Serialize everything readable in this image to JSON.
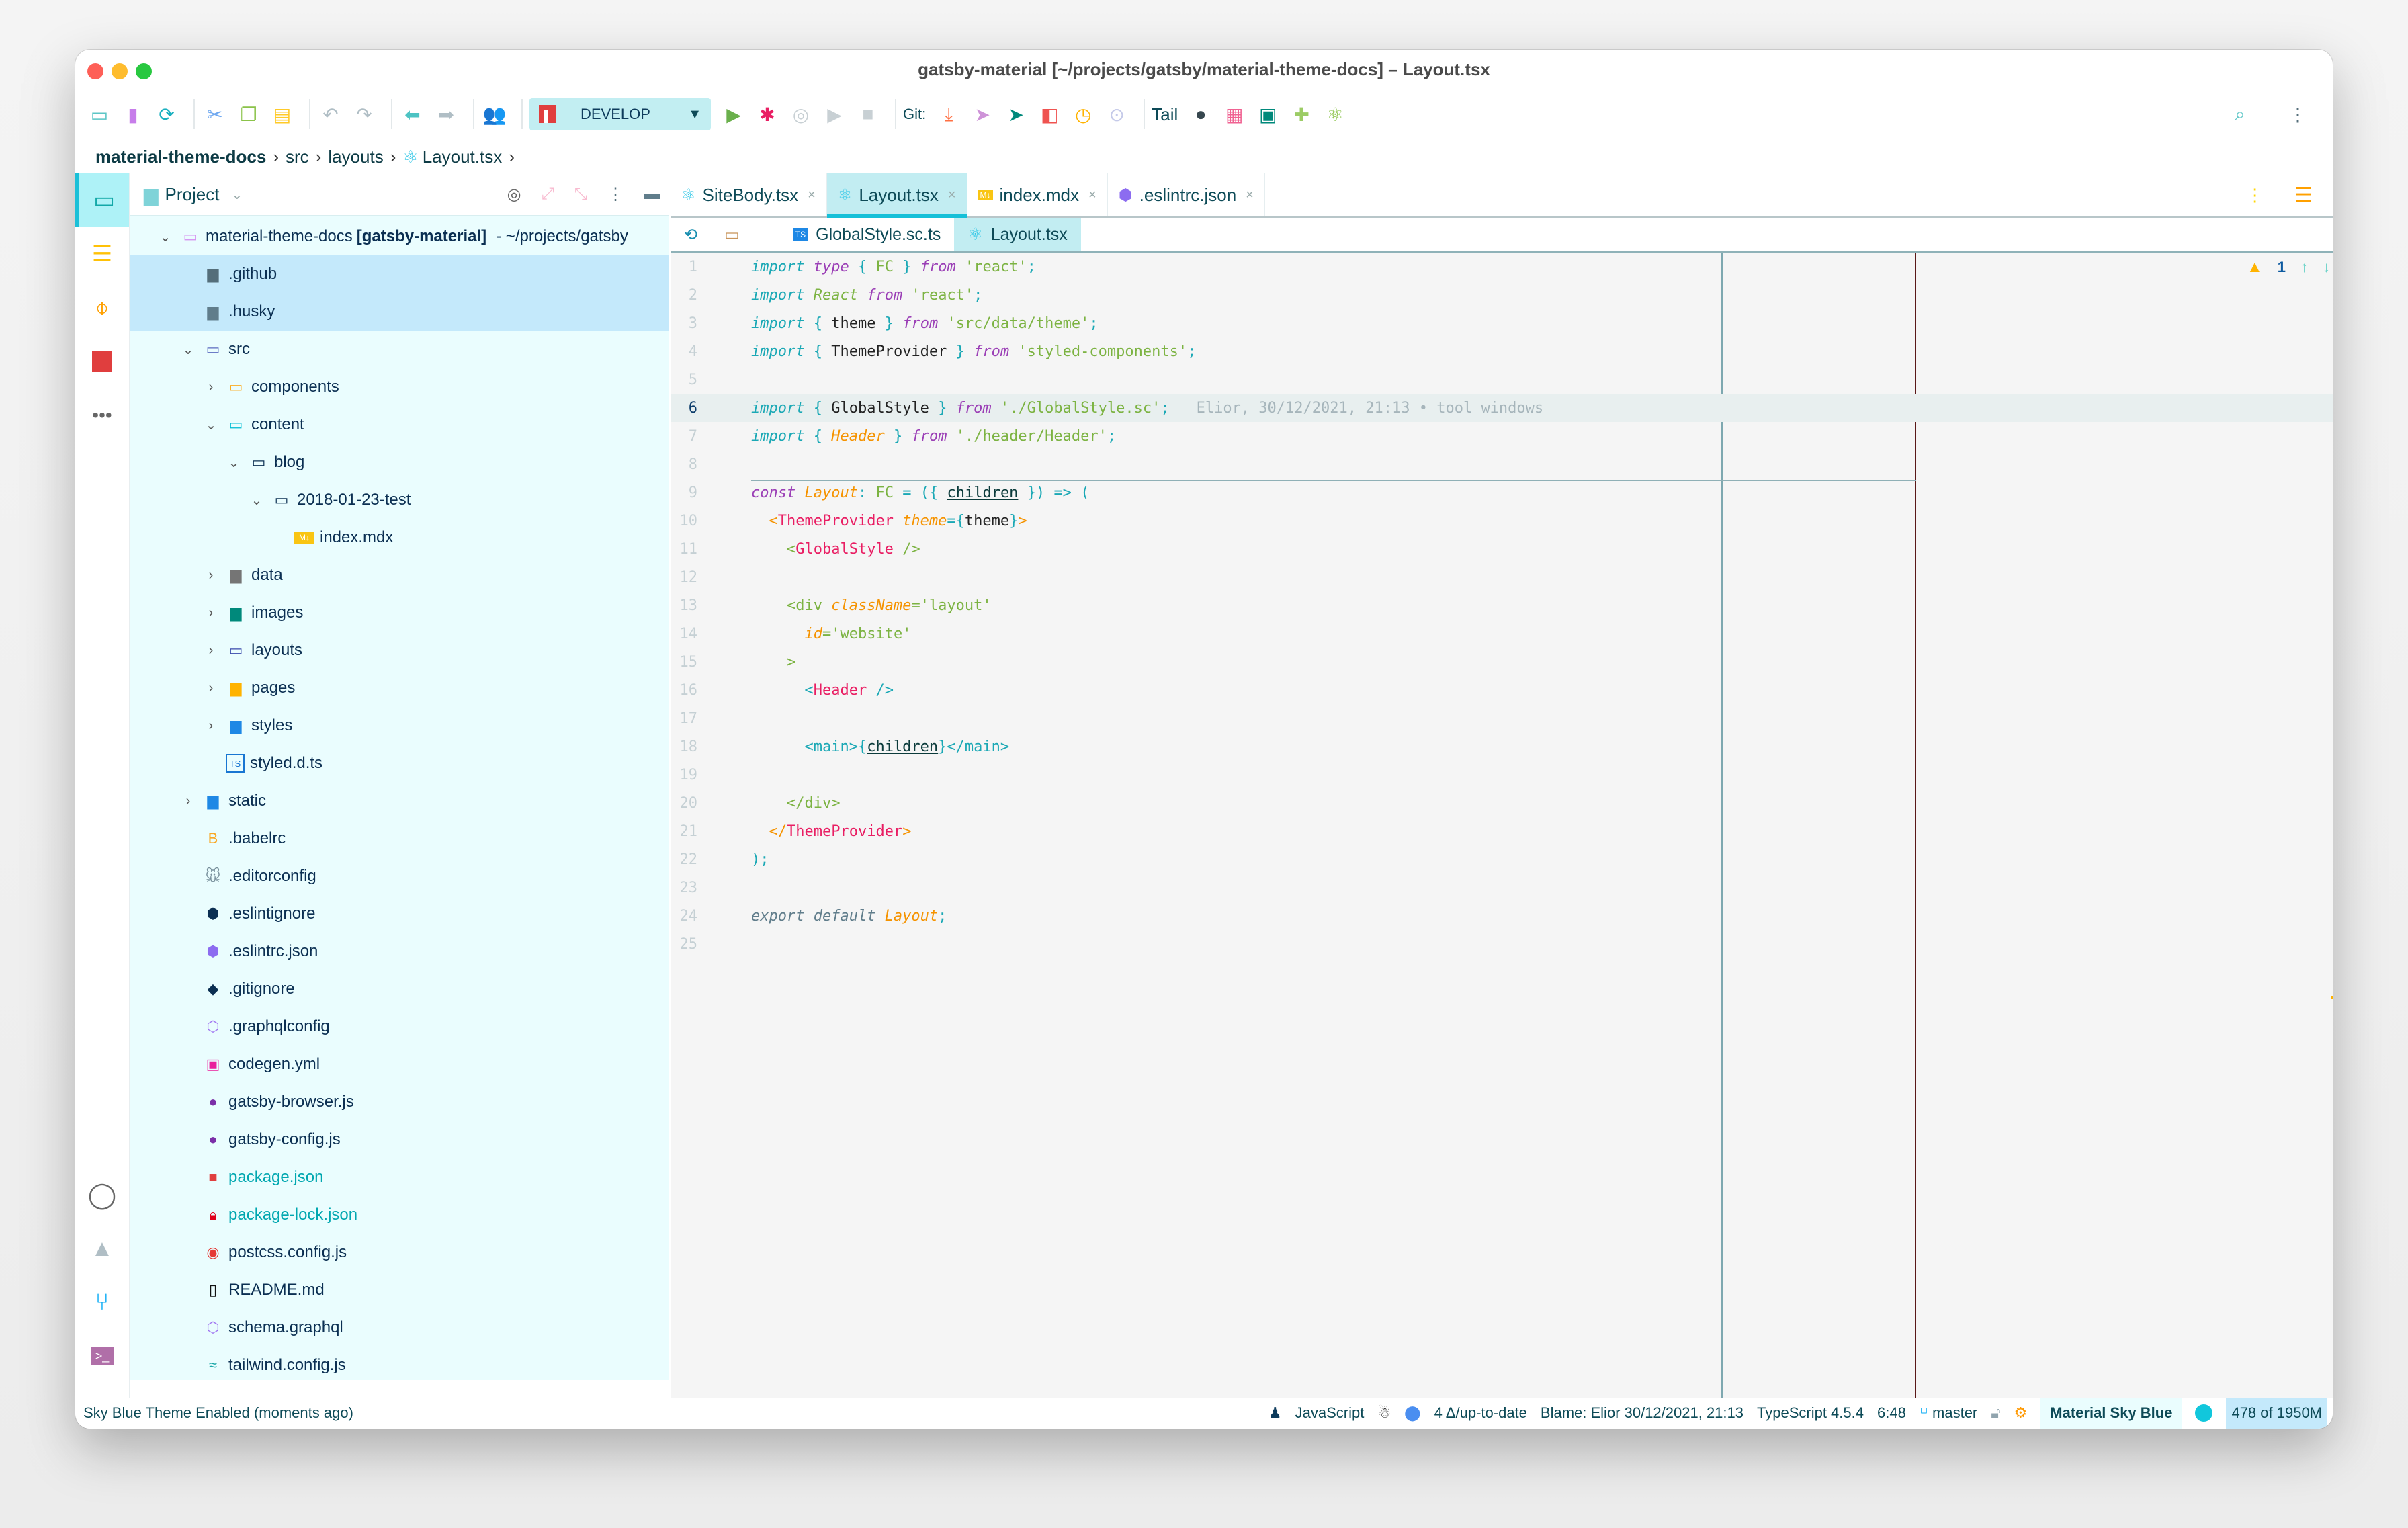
{
  "window": {
    "title": "gatsby-material [~/projects/gatsby/material-theme-docs] – Layout.tsx"
  },
  "toolbar": {
    "run_config": "DEVELOP",
    "git_label": "Git:",
    "tail_label": "Tail",
    "icons": [
      "open-folder-icon",
      "save-icon",
      "sync-icon",
      "cut-icon",
      "copy-icon",
      "paste-icon",
      "undo-icon",
      "redo-icon",
      "back-icon",
      "forward-icon",
      "users-icon",
      "run-icon",
      "debug-icon",
      "coverage-icon",
      "profile-icon",
      "stop-icon",
      "git-update-icon",
      "git-commit-icon",
      "git-push-icon",
      "git-compare-icon",
      "git-history-icon",
      "git-rollback-icon",
      "record-icon",
      "plugins-grid-icon",
      "database-tool-icon",
      "plugin-icon",
      "atom-icon",
      "search-icon",
      "more-icon"
    ]
  },
  "breadcrumb": {
    "items": [
      "material-theme-docs",
      "src",
      "layouts",
      "Layout.tsx"
    ]
  },
  "project": {
    "title": "Project",
    "root_name": "material-theme-docs",
    "root_module": "[gatsby-material]",
    "root_path": "- ~/projects/gatsby",
    "items": [
      {
        "label": ".github",
        "depth": 1,
        "arrow": "",
        "icon": "github-folder-icon",
        "selected": true
      },
      {
        "label": ".husky",
        "depth": 1,
        "arrow": "",
        "icon": "husky-folder-icon",
        "selected": true
      },
      {
        "label": "src",
        "depth": 1,
        "arrow": "v",
        "icon": "src-folder-icon"
      },
      {
        "label": "components",
        "depth": 2,
        "arrow": ">",
        "icon": "components-folder-icon"
      },
      {
        "label": "content",
        "depth": 2,
        "arrow": "v",
        "icon": "content-folder-icon"
      },
      {
        "label": "blog",
        "depth": 3,
        "arrow": "v",
        "icon": "folder-icon"
      },
      {
        "label": "2018-01-23-test",
        "depth": 4,
        "arrow": "v",
        "icon": "folder-icon"
      },
      {
        "label": "index.mdx",
        "depth": 5,
        "arrow": "",
        "icon": "mdx-icon"
      },
      {
        "label": "data",
        "depth": 2,
        "arrow": ">",
        "icon": "data-folder-icon"
      },
      {
        "label": "images",
        "depth": 2,
        "arrow": ">",
        "icon": "images-folder-icon"
      },
      {
        "label": "layouts",
        "depth": 2,
        "arrow": ">",
        "icon": "layouts-folder-icon"
      },
      {
        "label": "pages",
        "depth": 2,
        "arrow": ">",
        "icon": "pages-folder-icon"
      },
      {
        "label": "styles",
        "depth": 2,
        "arrow": ">",
        "icon": "styles-folder-icon"
      },
      {
        "label": "styled.d.ts",
        "depth": 2,
        "arrow": "",
        "icon": "typescript-icon"
      },
      {
        "label": "static",
        "depth": 1,
        "arrow": ">",
        "icon": "static-folder-icon"
      },
      {
        "label": ".babelrc",
        "depth": 1,
        "arrow": "",
        "icon": "babel-icon"
      },
      {
        "label": ".editorconfig",
        "depth": 1,
        "arrow": "",
        "icon": "editorconfig-icon"
      },
      {
        "label": ".eslintignore",
        "depth": 1,
        "arrow": "",
        "icon": "eslint-ignore-icon"
      },
      {
        "label": ".eslintrc.json",
        "depth": 1,
        "arrow": "",
        "icon": "eslint-icon"
      },
      {
        "label": ".gitignore",
        "depth": 1,
        "arrow": "",
        "icon": "git-icon"
      },
      {
        "label": ".graphqlconfig",
        "depth": 1,
        "arrow": "",
        "icon": "graphql-icon"
      },
      {
        "label": "codegen.yml",
        "depth": 1,
        "arrow": "",
        "icon": "codegen-icon"
      },
      {
        "label": "gatsby-browser.js",
        "depth": 1,
        "arrow": "",
        "icon": "gatsby-icon"
      },
      {
        "label": "gatsby-config.js",
        "depth": 1,
        "arrow": "",
        "icon": "gatsby-icon"
      },
      {
        "label": "package.json",
        "depth": 1,
        "arrow": "",
        "icon": "npm-icon",
        "modified": true
      },
      {
        "label": "package-lock.json",
        "depth": 1,
        "arrow": "",
        "icon": "lock-icon",
        "modified": true
      },
      {
        "label": "postcss.config.js",
        "depth": 1,
        "arrow": "",
        "icon": "postcss-icon"
      },
      {
        "label": "README.md",
        "depth": 1,
        "arrow": "",
        "icon": "readme-icon"
      },
      {
        "label": "schema.graphql",
        "depth": 1,
        "arrow": "",
        "icon": "graphql-icon"
      },
      {
        "label": "tailwind.config.js",
        "depth": 1,
        "arrow": "",
        "icon": "tailwind-icon"
      }
    ]
  },
  "tabs": [
    {
      "label": "SiteBody.tsx",
      "icon": "react-icon",
      "active": false
    },
    {
      "label": "Layout.tsx",
      "icon": "react-icon",
      "active": true
    },
    {
      "label": "index.mdx",
      "icon": "mdx-icon",
      "active": false
    },
    {
      "label": ".eslintrc.json",
      "icon": "eslint-icon",
      "active": false
    }
  ],
  "subtabs": [
    {
      "label": "GlobalStyle.sc.ts",
      "icon": "typescript-icon",
      "active": false
    },
    {
      "label": "Layout.tsx",
      "icon": "react-icon",
      "active": true
    }
  ],
  "editor": {
    "current_line": 6,
    "blame_annotation": "Elior, 30/12/2021, 21:13 • tool windows",
    "warnings": "1",
    "line_numbers": [
      "1",
      "2",
      "3",
      "4",
      "5",
      "6",
      "7",
      "8",
      "9",
      "10",
      "11",
      "12",
      "13",
      "14",
      "15",
      "16",
      "17",
      "18",
      "19",
      "20",
      "21",
      "22",
      "23",
      "24",
      "25"
    ]
  },
  "status": {
    "message": "Sky Blue Theme Enabled (moments ago)",
    "language": "JavaScript",
    "vcs_changes": "4 Δ/up-to-date",
    "blame": "Blame: Elior 30/12/2021, 21:13",
    "typescript": "TypeScript 4.5.4",
    "position": "6:48",
    "branch": "master",
    "theme": "Material Sky Blue",
    "memory": "478 of 1950M"
  }
}
